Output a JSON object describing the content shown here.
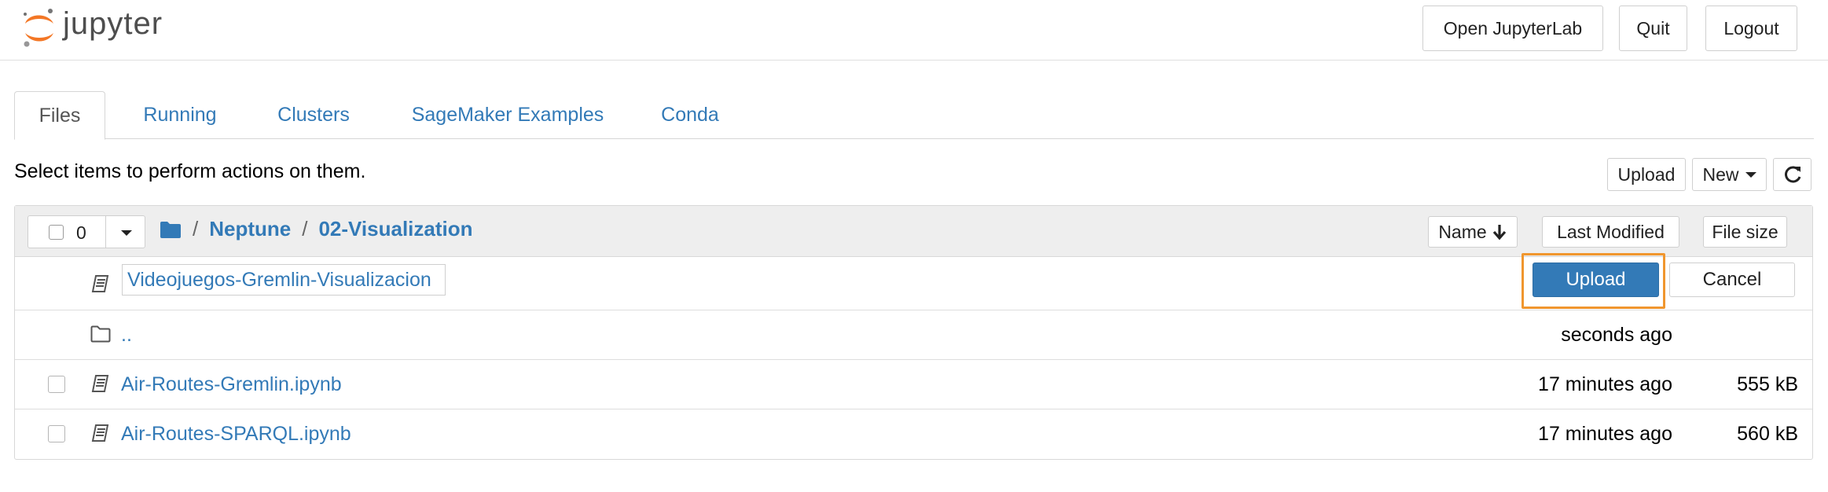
{
  "header": {
    "logo_text": "jupyter",
    "open_lab_label": "Open JupyterLab",
    "quit_label": "Quit",
    "logout_label": "Logout"
  },
  "tabs": [
    {
      "label": "Files",
      "active": true
    },
    {
      "label": "Running",
      "active": false
    },
    {
      "label": "Clusters",
      "active": false
    },
    {
      "label": "SageMaker Examples",
      "active": false
    },
    {
      "label": "Conda",
      "active": false
    }
  ],
  "toolbar": {
    "hint": "Select items to perform actions on them.",
    "upload_label": "Upload",
    "new_label": "New",
    "refresh_icon": "refresh-icon"
  },
  "list": {
    "selected_count": "0",
    "breadcrumb": [
      "Neptune",
      "02-Visualization"
    ],
    "breadcrumb_sep": "/",
    "sort_name_label": "Name",
    "sort_modified_label": "Last Modified",
    "sort_size_label": "File size",
    "pending_upload": {
      "filename": "Videojuegos-Gremlin-Visualizacion",
      "upload_label": "Upload",
      "cancel_label": "Cancel"
    },
    "rows": [
      {
        "name": "..",
        "type": "folder",
        "modified": "seconds ago",
        "size": ""
      },
      {
        "name": "Air-Routes-Gremlin.ipynb",
        "type": "notebook",
        "modified": "17 minutes ago",
        "size": "555 kB"
      },
      {
        "name": "Air-Routes-SPARQL.ipynb",
        "type": "notebook",
        "modified": "17 minutes ago",
        "size": "560 kB"
      }
    ]
  },
  "colors": {
    "link": "#337ab7",
    "primary": "#337ab7",
    "highlight": "#f0962e",
    "logo_orange": "#f37726"
  }
}
